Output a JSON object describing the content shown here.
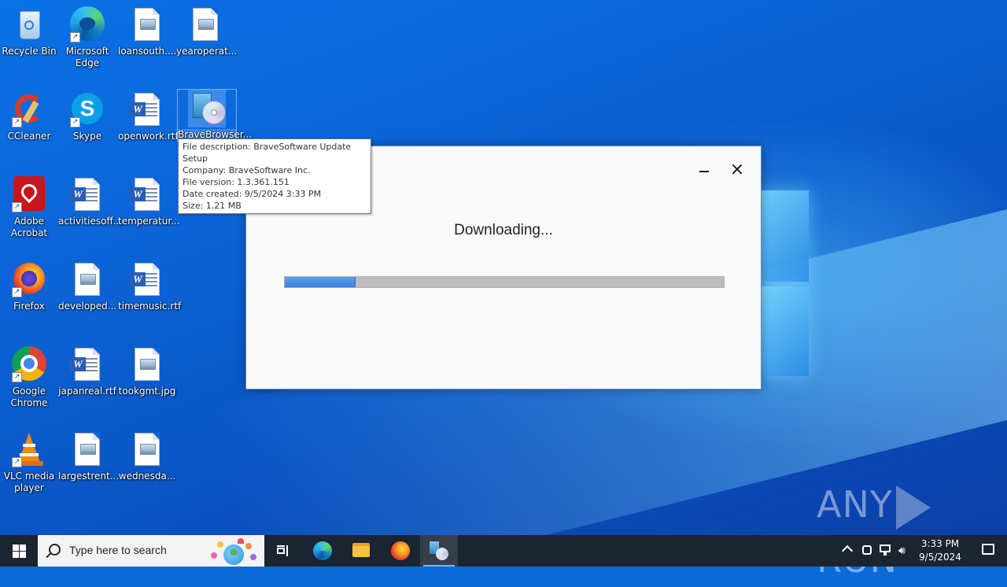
{
  "desktop": {
    "icons": [
      {
        "label": "Recycle Bin"
      },
      {
        "label": "Microsoft Edge"
      },
      {
        "label": "loansouth...."
      },
      {
        "label": "yearoperat..."
      },
      {
        "label": "CCleaner"
      },
      {
        "label": "Skype"
      },
      {
        "label": "openwork.rtf"
      },
      {
        "label": "BraveBrowser..."
      },
      {
        "label": "Adobe Acrobat"
      },
      {
        "label": "activitiesoff..."
      },
      {
        "label": "temperatur..."
      },
      {
        "label": "Firefox"
      },
      {
        "label": "developed..."
      },
      {
        "label": "timemusic.rtf"
      },
      {
        "label": "Google Chrome"
      },
      {
        "label": "japanreal.rtf"
      },
      {
        "label": "tookgmt.jpg"
      },
      {
        "label": "VLC media player"
      },
      {
        "label": "largestrent..."
      },
      {
        "label": "wednesda..."
      }
    ]
  },
  "tooltip": {
    "lines": [
      "File description: BraveSoftware Update Setup",
      "Company: BraveSoftware Inc.",
      "File version: 1.3.361.151",
      "Date created: 9/5/2024 3:33 PM",
      "Size: 1.21 MB"
    ]
  },
  "dialog": {
    "status": "Downloading...",
    "progress_fraction": 0.16,
    "minimize_glyph": "minimize-icon",
    "close_glyph": "×"
  },
  "watermark": {
    "left": "ANY",
    "right": "RUN"
  },
  "taskbar": {
    "search_placeholder": "Type here to search",
    "clock_time": "3:33 PM",
    "clock_date": "9/5/2024",
    "pinned": [
      "task-view-icon",
      "edge-icon",
      "file-explorer-icon",
      "firefox-icon",
      "brave-setup-icon"
    ]
  },
  "colors": {
    "taskbar": "#1b2431",
    "progress_fill": "#3a7fdc",
    "progress_track": "#bcbcbc",
    "accent": "#77b7f5"
  }
}
